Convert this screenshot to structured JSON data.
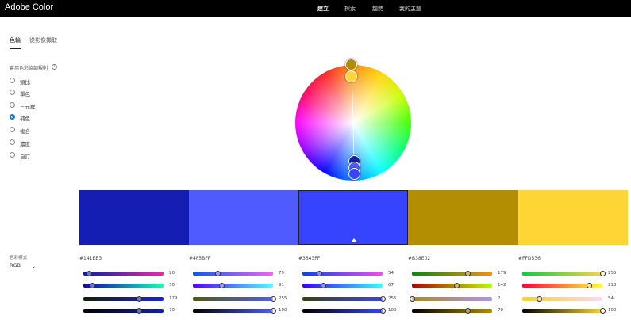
{
  "header": {
    "brand": "Adobe Color",
    "nav": [
      {
        "label": "建立",
        "active": true
      },
      {
        "label": "探索",
        "active": false
      },
      {
        "label": "趨勢",
        "active": false
      },
      {
        "label": "我的主題",
        "active": false
      }
    ]
  },
  "subtabs": [
    {
      "label": "色輪",
      "active": true
    },
    {
      "label": "從影像擷取",
      "active": false
    }
  ],
  "harmony": {
    "title": "套用色彩協調規則",
    "help_icon": "help-circle-icon",
    "rules": [
      {
        "label": "類比",
        "selected": false
      },
      {
        "label": "單色",
        "selected": false
      },
      {
        "label": "三元群",
        "selected": false
      },
      {
        "label": "補色",
        "selected": true
      },
      {
        "label": "複合",
        "selected": false
      },
      {
        "label": "濃度",
        "selected": false
      },
      {
        "label": "自訂",
        "selected": false
      }
    ]
  },
  "color_mode": {
    "label": "色彩模式",
    "value": "RGB",
    "icon": "chevron-down-icon"
  },
  "swatches": [
    {
      "hex": "#141EB3",
      "color": "#141EB3",
      "selected": false,
      "rgb": [
        20,
        30,
        179
      ],
      "brightness": 70
    },
    {
      "hex": "#4F5BFF",
      "color": "#4F5BFF",
      "selected": false,
      "rgb": [
        79,
        91,
        255
      ],
      "brightness": 100
    },
    {
      "hex": "#3643FF",
      "color": "#3643FF",
      "selected": true,
      "rgb": [
        54,
        67,
        255
      ],
      "brightness": 100
    },
    {
      "hex": "#B38E02",
      "color": "#B38E02",
      "selected": false,
      "rgb": [
        179,
        142,
        2
      ],
      "brightness": 70
    },
    {
      "hex": "#FFD536",
      "color": "#FFD536",
      "selected": false,
      "rgb": [
        255,
        213,
        54
      ],
      "brightness": 100
    }
  ]
}
